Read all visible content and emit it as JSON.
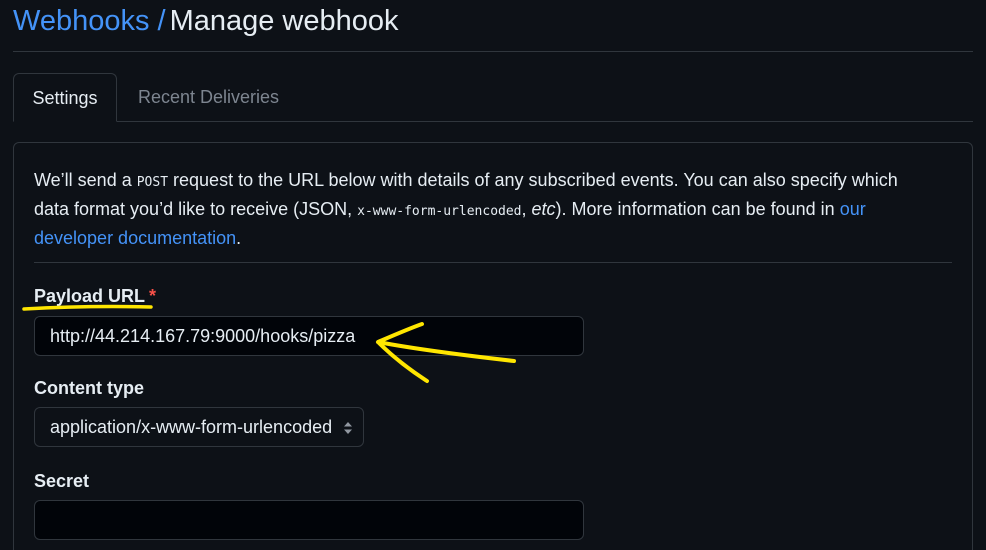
{
  "header": {
    "breadcrumb_link": "Webhooks",
    "separator": "/",
    "current": "Manage webhook"
  },
  "tabs": [
    {
      "label": "Settings",
      "active": true
    },
    {
      "label": "Recent Deliveries",
      "active": false
    }
  ],
  "intro": {
    "part1": "We’ll send a ",
    "code_post": "POST",
    "part2": " request to the URL below with details of any subscribed events. You can also specify which data format you’d like to receive (JSON, ",
    "code_format": "x-www-form-urlencoded",
    "part3": ", ",
    "etc": "etc",
    "part4": "). More information can be found in ",
    "link": "our developer documentation",
    "part5": "."
  },
  "payload_url": {
    "label": "Payload URL",
    "required_mark": "*",
    "value": "http://44.214.167.79:9000/hooks/pizza"
  },
  "content_type": {
    "label": "Content type",
    "value": "application/x-www-form-urlencoded"
  },
  "secret": {
    "label": "Secret",
    "value": ""
  },
  "colors": {
    "background": "#0d1117",
    "link": "#4493f8",
    "required": "#f85149",
    "annotation": "#ffe600"
  }
}
